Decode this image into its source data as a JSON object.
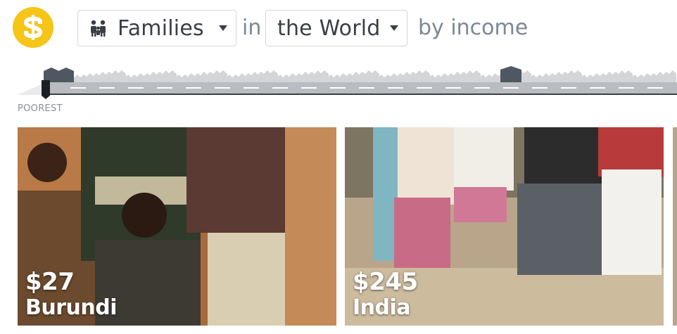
{
  "header": {
    "logo_icon": "dollar-street-logo-icon",
    "things_dropdown": {
      "label": "Families",
      "icon": "family-icon"
    },
    "connector_in": "in",
    "place_dropdown": {
      "label": "the World"
    },
    "connector_by": "by income"
  },
  "street": {
    "left_label": "POOREST",
    "handle": "income-slider-handle",
    "colors": {
      "road": "#b9bcc0",
      "house_active": "#4f5862",
      "house_faded": "#d3d5d8"
    }
  },
  "cards": [
    {
      "income": "$27",
      "country": "Burundi"
    },
    {
      "income": "$245",
      "country": "India"
    }
  ],
  "colors": {
    "accent": "#f5c518",
    "text_dark": "#3a3f45",
    "text_muted": "#7c8894"
  }
}
